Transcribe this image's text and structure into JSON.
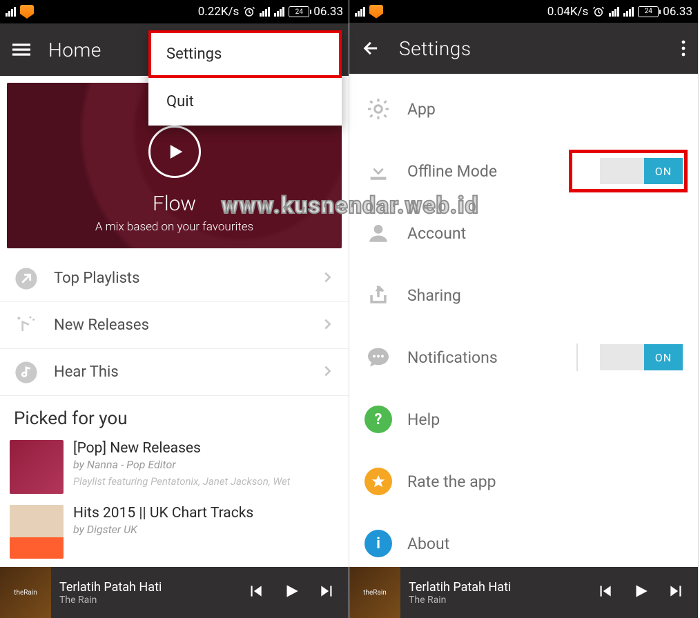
{
  "watermark": "www.kusnendar.web.id",
  "status": {
    "speed_left": "0.22K/s",
    "speed_right": "0.04K/s",
    "time": "06.33",
    "battery": "24"
  },
  "left": {
    "title": "Home",
    "menu": {
      "settings": "Settings",
      "quit": "Quit"
    },
    "hero": {
      "title": "Flow",
      "subtitle": "A mix based on your favourites"
    },
    "rows": {
      "top": "Top Playlists",
      "new": "New Releases",
      "hear": "Hear This"
    },
    "picked_title": "Picked for you",
    "picked": [
      {
        "title": "[Pop] New Releases",
        "by": "by Nanna - Pop Editor",
        "desc": "Playlist featuring Pentatonix, Janet Jackson, Wet"
      },
      {
        "title": "Hits 2015 || UK Chart Tracks",
        "by": "by Digster UK",
        "desc": ""
      }
    ]
  },
  "right": {
    "title": "Settings",
    "items": {
      "app": "App",
      "offline": "Offline Mode",
      "account": "Account",
      "sharing": "Sharing",
      "notifications": "Notifications",
      "help": "Help",
      "rate": "Rate the app",
      "about": "About"
    },
    "toggle_on": "ON"
  },
  "player": {
    "title": "Terlatih Patah Hati",
    "artist": "The Rain"
  }
}
